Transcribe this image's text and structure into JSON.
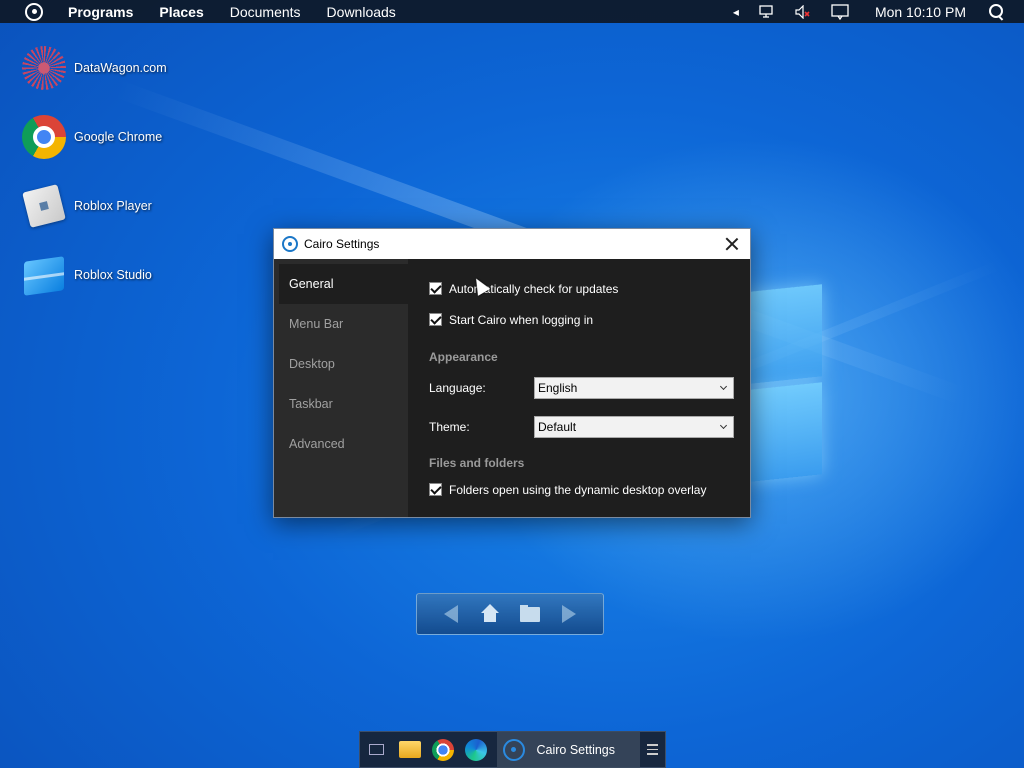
{
  "menubar": {
    "items": [
      "Programs",
      "Places",
      "Documents",
      "Downloads"
    ],
    "clock": "Mon 10:10 PM",
    "tray_icons": [
      "tray-expand-icon",
      "network-icon",
      "volume-muted-icon",
      "action-center-icon"
    ]
  },
  "desktop": {
    "icons": [
      {
        "label": "DataWagon.com",
        "icon": "datawagon-icon"
      },
      {
        "label": "Google Chrome",
        "icon": "chrome-icon"
      },
      {
        "label": "Roblox Player",
        "icon": "roblox-player-icon"
      },
      {
        "label": "Roblox Studio",
        "icon": "roblox-studio-icon"
      }
    ]
  },
  "settings": {
    "title": "Cairo Settings",
    "sidebar": [
      "General",
      "Menu Bar",
      "Desktop",
      "Taskbar",
      "Advanced"
    ],
    "active_tab": "General",
    "general": {
      "auto_update": {
        "label": "Automatically check for updates",
        "checked": true
      },
      "start_login": {
        "label": "Start Cairo when logging in",
        "checked": true
      },
      "appearance_heading": "Appearance",
      "language_label": "Language:",
      "language_value": "English",
      "theme_label": "Theme:",
      "theme_value": "Default",
      "files_heading": "Files and folders",
      "dynamic_overlay": {
        "label": "Folders open using the dynamic desktop overlay",
        "checked": true
      }
    }
  },
  "taskbar": {
    "task_label": "Cairo Settings"
  }
}
